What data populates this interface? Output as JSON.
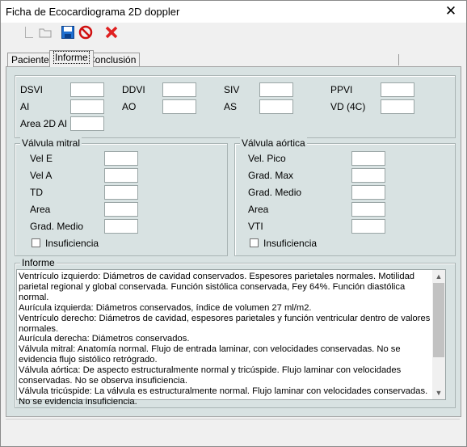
{
  "window": {
    "title": "Ficha de Ecocardiograma 2D doppler",
    "close_glyph": "✕"
  },
  "toolbar": {
    "icons": [
      "new-icon",
      "open-icon",
      "save-icon",
      "cancel-icon",
      "delete-icon"
    ]
  },
  "tabs": [
    {
      "label": "Paciente"
    },
    {
      "label": "Informe"
    },
    {
      "label": "Conclusión"
    }
  ],
  "measures": {
    "dsvi": "DSVI",
    "ddvi": "DDVI",
    "siv": "SIV",
    "ppvi": "PPVI",
    "ai": "AI",
    "ao": "AO",
    "as": "AS",
    "vd": "VD (4C)",
    "area_ai": "Area 2D AI"
  },
  "mitral": {
    "title": "Válvula mitral",
    "fields": [
      "Vel E",
      "Vel A",
      "TD",
      "Area",
      "Grad. Medio"
    ],
    "insuf": "Insuficiencia"
  },
  "aortic": {
    "title": "Válvula aórtica",
    "fields": [
      "Vel. Pico",
      "Grad. Max",
      "Grad. Medio",
      "Area",
      "VTI"
    ],
    "insuf": "Insuficiencia"
  },
  "informe": {
    "title": "Informe",
    "lines": [
      "Ventrículo izquierdo: Diámetros de cavidad conservados. Espesores parietales normales. Motilidad parietal regional y global conservada. Función sistólica conservada, Fey 64%. Función diastólica normal.",
      "Aurícula izquierda: Diámetros conservados, índice de volumen 27 ml/m2.",
      "Ventrículo derecho: Diámetros de cavidad, espesores parietales y función ventricular dentro de valores normales.",
      "Aurícula derecha: Diámetros conservados.",
      "Válvula mitral: Anatomía normal. Flujo de entrada laminar, con velocidades conservadas. No se evidencia flujo sistólico retrógrado.",
      "Válvula aórtica: De aspecto estructuralmente normal y tricúspide. Flujo laminar con velocidades conservadas. No se observa insuficiencia.",
      "Válvula tricúspide: La válvula es estructuralmente normal. Flujo laminar con velocidades conservadas. No se evidencia insuficiencia."
    ]
  }
}
